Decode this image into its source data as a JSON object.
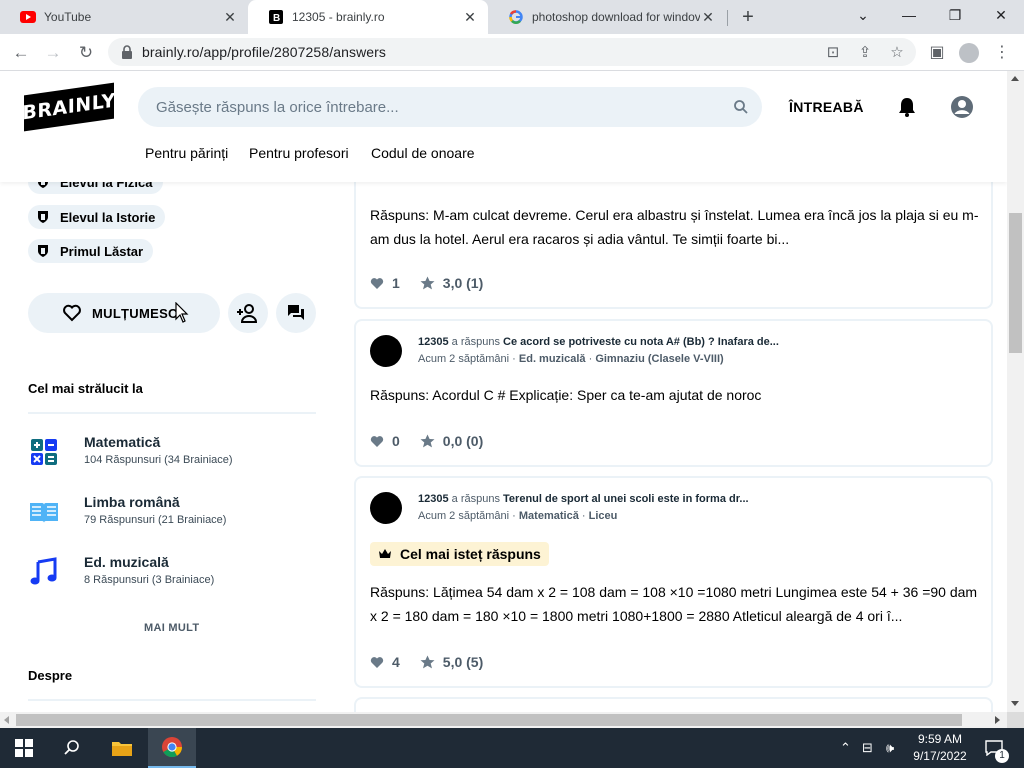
{
  "browser": {
    "tabs": [
      {
        "title": "YouTube",
        "active": false
      },
      {
        "title": "12305 - brainly.ro",
        "active": true
      },
      {
        "title": "photoshop download for windov",
        "active": false
      }
    ],
    "new_tab": "+",
    "url": "brainly.ro/app/profile/2807258/answers"
  },
  "site": {
    "logo": "BRAINLY",
    "search_placeholder": "Găsește răspuns la orice întrebare...",
    "ask_button": "ÎNTREABĂ",
    "subnav": [
      "Pentru părinți",
      "Pentru profesori",
      "Codul de onoare"
    ]
  },
  "sidebar": {
    "badges": [
      "Elevul la Fizică",
      "Elevul la Istorie",
      "Primul Lăstar"
    ],
    "thanks_button": "MULȚUMESC",
    "best_in_title": "Cel mai strălucit la",
    "subjects": [
      {
        "name": "Matematică",
        "stat": "104 Răspunsuri (34 Brainiace)",
        "icon": "math-icon",
        "color": "#163bf3"
      },
      {
        "name": "Limba română",
        "stat": "79 Răspunsuri (21 Brainiace)",
        "icon": "book-icon",
        "color": "#4fb3f6"
      },
      {
        "name": "Ed. muzicală",
        "stat": "8 Răspunsuri (3 Brainiace)",
        "icon": "music-icon",
        "color": "#163bf3"
      }
    ],
    "more": "MAI MULT",
    "about_title": "Despre"
  },
  "answers": [
    {
      "text": "Răspuns: M-am culcat devreme. Cerul era albastru și înstelat. Lumea era încă jos la plaja si eu m-am dus la hotel. Aerul era racaros și adia vântul. Te simții foarte bi...",
      "likes": "1",
      "rating": "3,0 (1)"
    },
    {
      "user": "12305",
      "action": "a răspuns",
      "question": "Ce acord se potriveste cu nota A# (Bb) ? Inafara de...",
      "time": "Acum 2 săptămâni",
      "subject": "Ed. muzicală",
      "level": "Gimnaziu (Clasele V-VIII)",
      "text": "Răspuns: Acordul C # Explicație: Sper ca te-am ajutat de noroc",
      "likes": "0",
      "rating": "0,0 (0)"
    },
    {
      "user": "12305",
      "action": "a răspuns",
      "question": "Terenul de sport al unei scoli este in forma dr...",
      "time": "Acum 2 săptămâni",
      "subject": "Matematică",
      "level": "Liceu",
      "best_label": "Cel mai isteț răspuns",
      "text": "Răspuns: Lățimea 54 dam x 2 = 108 dam = 108 ×10 =1080 metri Lungimea este 54 + 36 =90 dam x 2 = 180 dam = 180 ×10 = 1800 metri 1080+1800 = 2880 Atleticul aleargă de 4 ori î...",
      "likes": "4",
      "rating": "5,0 (5)"
    }
  ],
  "taskbar": {
    "time": "9:59 AM",
    "date": "9/17/2022",
    "notifications": "1"
  },
  "colors": {
    "brand_light": "#ebf2f7",
    "best_bg": "#fdf3d4",
    "taskbar": "#1f2a36"
  }
}
